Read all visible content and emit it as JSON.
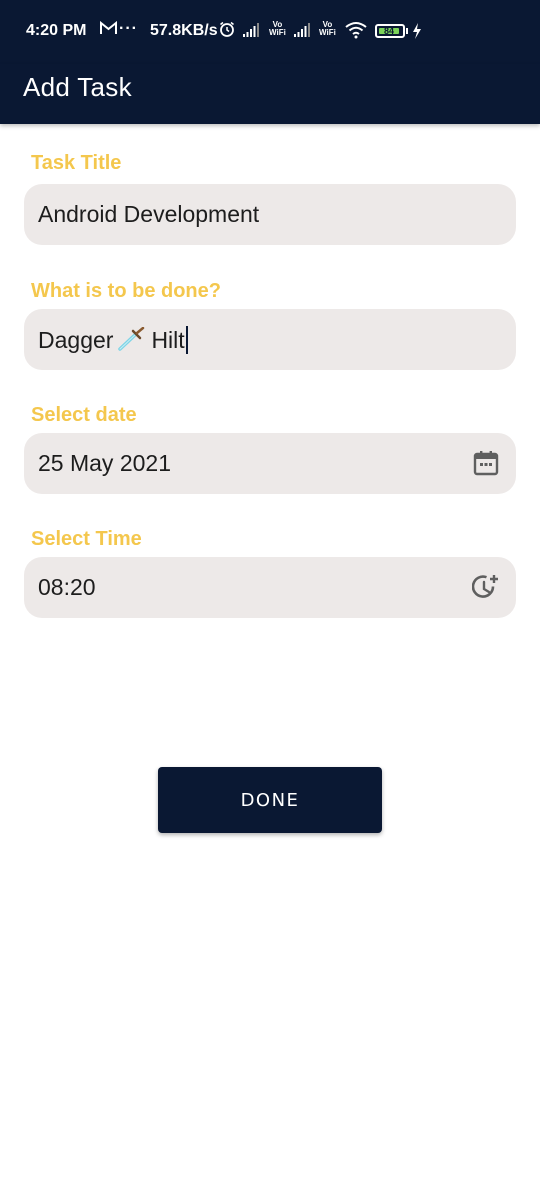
{
  "status_bar": {
    "time": "4:20 PM",
    "mail_icon": "gmail-icon",
    "more": "···",
    "speed": "57.8KB/s",
    "alarm_icon": "alarm-icon",
    "signal_icon": "signal-icon",
    "vowifi_1": "Vo\nWiFi",
    "vowifi_2": "Vo\nWiFi",
    "wifi_icon": "wifi-icon",
    "battery_level": "84",
    "charging_icon": "bolt-icon"
  },
  "app_bar": {
    "title": "Add Task"
  },
  "form": {
    "task_title": {
      "label": "Task Title",
      "value": "Android Development"
    },
    "description": {
      "label": "What is to be done?",
      "value_before": "Dagger",
      "emoji_icon": "dagger-emoji-icon",
      "value_after": "Hilt"
    },
    "date": {
      "label": "Select date",
      "value": "25 May 2021",
      "icon": "calendar-icon"
    },
    "time": {
      "label": "Select Time",
      "value": "08:20",
      "icon": "add-alarm-icon"
    }
  },
  "done_button": {
    "label": "DONE"
  },
  "colors": {
    "primary_dark": "#0a1833",
    "label_accent": "#f4c74d",
    "field_background": "#ede9e8",
    "battery_fill": "#7cd35a"
  }
}
